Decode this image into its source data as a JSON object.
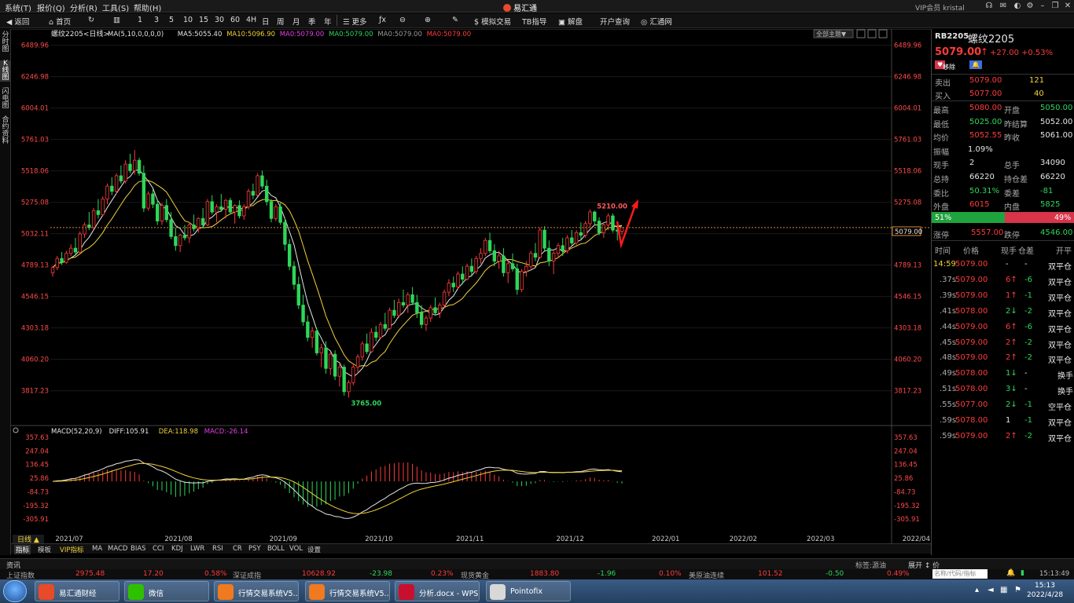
{
  "menu": {
    "items": [
      "系统(T)",
      "报价(Q)",
      "分析(R)",
      "工具(S)",
      "帮助(H)"
    ],
    "app_title": "易汇通",
    "user": "VIP会员 kristal"
  },
  "toolbar": {
    "back": "返回",
    "home": "首页",
    "periods": [
      "1",
      "3",
      "5",
      "10",
      "15",
      "30",
      "60",
      "4H",
      "日",
      "周",
      "月",
      "季",
      "年"
    ],
    "more": "更多",
    "sim_trade": "模拟交易",
    "tb_index": "TB指导",
    "jiepan": "解盘",
    "kaihu": "开户查询",
    "huitong": "汇通网"
  },
  "left_tabs": [
    "分时图",
    "K线图",
    "闪电图",
    "合约资料"
  ],
  "chart": {
    "symbol_label": "螺纹2205<日线>",
    "ma_legend": [
      {
        "text": "MA(5,10,0,0,0,0)",
        "color": "#e6e6e6"
      },
      {
        "text": "MA5:5055.40",
        "color": "#e6e6e6"
      },
      {
        "text": "MA10:5096.90",
        "color": "#f1d23a"
      },
      {
        "text": "MA0:5079.00",
        "color": "#e040e0"
      },
      {
        "text": "MA0:5079.00",
        "color": "#2fd65b"
      },
      {
        "text": "MA0:5079.00",
        "color": "#9a9a9a"
      },
      {
        "text": "MA0:5079.00",
        "color": "#ff3b3b"
      }
    ],
    "theme_button": "全部主题▼",
    "price_axis": [
      "6489.96",
      "6246.98",
      "6004.01",
      "5761.03",
      "5518.06",
      "5275.08",
      "5032.11",
      "4789.13",
      "4546.15",
      "4303.18",
      "4060.20",
      "3817.23"
    ],
    "current_price": "5079.00",
    "high_label": "5210.00",
    "low_label": "3765.00",
    "macd_legend": [
      {
        "text": "MACD(52,20,9)",
        "color": "#e6e6e6"
      },
      {
        "text": "DIFF:105.91",
        "color": "#e6e6e6"
      },
      {
        "text": "DEA:118.98",
        "color": "#f1d23a"
      },
      {
        "text": "MACD:-26.14",
        "color": "#e040e0"
      }
    ],
    "macd_axis": [
      "357.63",
      "247.04",
      "136.45",
      "25.86",
      "-84.73",
      "-195.32",
      "-305.91"
    ],
    "date_axis": [
      "2021/07",
      "2021/08",
      "2021/09",
      "2021/10",
      "2021/11",
      "2021/12",
      "2022/01",
      "2022/02",
      "2022/03",
      "2022/04"
    ],
    "period_label": "日线 ▲"
  },
  "bottom_tabs": [
    "指标",
    "模板",
    "VIP指标",
    "MA",
    "MACD",
    "BIAS",
    "CCI",
    "KDJ",
    "LWR",
    "RSI",
    "CR",
    "PSY",
    "BOLL",
    "VOL",
    "设置"
  ],
  "quote": {
    "code": "RB2205",
    "name": "螺纹2205",
    "price": "5079.00",
    "change": "+27.00",
    "pct": "+0.53%",
    "remove_btn": "移除",
    "sell": {
      "label": "卖出",
      "price": "5079.00",
      "vol": "121"
    },
    "buy": {
      "label": "买入",
      "price": "5077.00",
      "vol": "40"
    },
    "rows": [
      [
        "最高",
        "5080.00",
        "开盘",
        "5050.00"
      ],
      [
        "最低",
        "5025.00",
        "昨结算",
        "5052.00"
      ],
      [
        "均价",
        "5052.55",
        "昨收",
        "5061.00"
      ],
      [
        "振幅",
        "1.09%",
        "",
        ""
      ],
      [
        "现手",
        "2",
        "总手",
        "34090"
      ],
      [
        "总持",
        "66220",
        "持仓差",
        "66220"
      ],
      [
        "委比",
        "50.31%",
        "委差",
        "-81"
      ],
      [
        "外盘",
        "6015",
        "内盘",
        "5825"
      ]
    ],
    "bar_left": "51%",
    "bar_right": "49%",
    "limit": [
      "涨停",
      "5557.00",
      "跌停",
      "4546.00"
    ],
    "trade_headers": [
      "时间",
      "价格",
      "现手",
      "仓差",
      "开平"
    ],
    "trades": [
      [
        "14:59",
        "5079.00",
        "-",
        "-",
        "双平仓"
      ],
      [
        ".37s",
        "5079.00",
        "6↑",
        "-6",
        "双平仓"
      ],
      [
        ".39s",
        "5079.00",
        "1↑",
        "-1",
        "双平仓"
      ],
      [
        ".41s",
        "5078.00",
        "2↓",
        "-2",
        "双平仓"
      ],
      [
        ".44s",
        "5079.00",
        "6↑",
        "-6",
        "双平仓"
      ],
      [
        ".45s",
        "5079.00",
        "2↑",
        "-2",
        "双平仓"
      ],
      [
        ".48s",
        "5079.00",
        "2↑",
        "-2",
        "双平仓"
      ],
      [
        ".49s",
        "5078.00",
        "1↓",
        "-",
        "换手"
      ],
      [
        ".51s",
        "5078.00",
        "3↓",
        "-",
        "换手"
      ],
      [
        ".55s",
        "5077.00",
        "2↓",
        "-1",
        "空平仓"
      ],
      [
        ".59s",
        "5078.00",
        "1",
        "-1",
        "双平仓"
      ],
      [
        ".59s",
        "5079.00",
        "2↑",
        "-2",
        "双平仓"
      ]
    ]
  },
  "newsbar": {
    "left": "资讯",
    "tag": "标签:源油",
    "expand": "展开",
    "hint": "名称/代码/指标",
    "time": "15:13:49"
  },
  "ticker": [
    {
      "name": "上证指数",
      "val": "2975.48",
      "chg": "17.20",
      "pct": "0.58%"
    },
    {
      "name": "深证成指",
      "val": "10628.92",
      "chg": "-23.98",
      "pct": "0.23%"
    },
    {
      "name": "现货黄金",
      "val": "1883.80",
      "chg": "-1.96",
      "pct": "0.10%"
    },
    {
      "name": "美原油连续",
      "val": "101.52",
      "chg": "-0.50",
      "pct": "0.49%"
    }
  ],
  "taskbar": {
    "items": [
      {
        "label": "易汇通财经",
        "color": "#e84a2a"
      },
      {
        "label": "微信",
        "color": "#2dc100"
      },
      {
        "label": "行情交易系统V5....",
        "color": "#f07a1f"
      },
      {
        "label": "行情交易系统V5....",
        "color": "#f07a1f"
      },
      {
        "label": "分析.docx - WPS...",
        "color": "#c8102e"
      },
      {
        "label": "Pointofix",
        "color": "#d8d8d8"
      }
    ],
    "time": "15:13",
    "date": "2022/4/28"
  },
  "chart_data": {
    "type": "candlestick",
    "title": "螺纹2205<日线>",
    "x_range": [
      "2021/06/24",
      "2022/04/28"
    ],
    "y_range": [
      3700,
      6500
    ],
    "ohlc": [
      [
        4730,
        4780,
        4700,
        4770
      ],
      [
        4770,
        4860,
        4750,
        4840
      ],
      [
        4840,
        4890,
        4790,
        4810
      ],
      [
        4810,
        4900,
        4800,
        4880
      ],
      [
        4880,
        4950,
        4860,
        4920
      ],
      [
        4920,
        5000,
        4870,
        4890
      ],
      [
        4890,
        5050,
        4880,
        5030
      ],
      [
        5030,
        5120,
        5000,
        5100
      ],
      [
        5100,
        5200,
        5060,
        5080
      ],
      [
        5080,
        5230,
        5070,
        5210
      ],
      [
        5210,
        5300,
        5150,
        5180
      ],
      [
        5180,
        5320,
        5170,
        5300
      ],
      [
        5300,
        5420,
        5260,
        5400
      ],
      [
        5400,
        5470,
        5330,
        5360
      ],
      [
        5360,
        5500,
        5340,
        5480
      ],
      [
        5480,
        5560,
        5420,
        5440
      ],
      [
        5440,
        5600,
        5420,
        5570
      ],
      [
        5570,
        5650,
        5500,
        5520
      ],
      [
        5520,
        5680,
        5490,
        5600
      ],
      [
        5600,
        5620,
        5480,
        5500
      ],
      [
        5500,
        5560,
        5200,
        5230
      ],
      [
        5230,
        5360,
        5210,
        5340
      ],
      [
        5340,
        5380,
        5230,
        5260
      ],
      [
        5260,
        5300,
        5100,
        5130
      ],
      [
        5130,
        5270,
        5100,
        5250
      ],
      [
        5250,
        5300,
        5120,
        5140
      ],
      [
        5140,
        5200,
        4990,
        5010
      ],
      [
        5010,
        5080,
        4900,
        4940
      ],
      [
        4940,
        5030,
        4890,
        5020
      ],
      [
        5020,
        5100,
        4980,
        5000
      ],
      [
        5000,
        5120,
        4960,
        5100
      ],
      [
        5100,
        5180,
        5050,
        5070
      ],
      [
        5070,
        5160,
        5040,
        5150
      ],
      [
        5150,
        5230,
        5080,
        5100
      ],
      [
        5100,
        5300,
        5090,
        5280
      ],
      [
        5280,
        5330,
        5180,
        5200
      ],
      [
        5200,
        5260,
        5120,
        5240
      ],
      [
        5240,
        5340,
        5200,
        5220
      ],
      [
        5220,
        5300,
        5150,
        5290
      ],
      [
        5290,
        5310,
        5180,
        5200
      ],
      [
        5200,
        5260,
        5110,
        5250
      ],
      [
        5250,
        5290,
        5150,
        5170
      ],
      [
        5170,
        5260,
        5140,
        5240
      ],
      [
        5240,
        5380,
        5220,
        5360
      ],
      [
        5360,
        5420,
        5300,
        5330
      ],
      [
        5330,
        5500,
        5320,
        5480
      ],
      [
        5480,
        5520,
        5380,
        5400
      ],
      [
        5400,
        5450,
        5250,
        5280
      ],
      [
        5280,
        5300,
        5120,
        5150
      ],
      [
        5150,
        5260,
        5130,
        5240
      ],
      [
        5240,
        5270,
        5100,
        5120
      ],
      [
        5120,
        5150,
        4900,
        4950
      ],
      [
        4950,
        4990,
        4750,
        4780
      ],
      [
        4780,
        4820,
        4600,
        4640
      ],
      [
        4640,
        4700,
        4450,
        4480
      ],
      [
        4480,
        4560,
        4320,
        4350
      ],
      [
        4350,
        4400,
        4200,
        4230
      ],
      [
        4230,
        4310,
        4150,
        4280
      ],
      [
        4280,
        4300,
        4090,
        4110
      ],
      [
        4110,
        4180,
        4000,
        4150
      ],
      [
        4150,
        4200,
        3950,
        3990
      ],
      [
        3990,
        4120,
        3940,
        4100
      ],
      [
        4100,
        4130,
        3900,
        3930
      ],
      [
        3930,
        4030,
        3850,
        4000
      ],
      [
        4000,
        4020,
        3780,
        3810
      ],
      [
        3810,
        3900,
        3765,
        3880
      ],
      [
        3880,
        4020,
        3860,
        4000
      ],
      [
        4000,
        4100,
        3950,
        4080
      ],
      [
        4080,
        4200,
        4050,
        4180
      ],
      [
        4180,
        4260,
        4100,
        4120
      ],
      [
        4120,
        4300,
        4110,
        4270
      ],
      [
        4270,
        4320,
        4200,
        4230
      ],
      [
        4230,
        4350,
        4220,
        4330
      ],
      [
        4330,
        4420,
        4280,
        4300
      ],
      [
        4300,
        4460,
        4290,
        4440
      ],
      [
        4440,
        4520,
        4380,
        4400
      ],
      [
        4400,
        4530,
        4380,
        4500
      ],
      [
        4500,
        4600,
        4460,
        4480
      ],
      [
        4480,
        4580,
        4420,
        4560
      ],
      [
        4560,
        4620,
        4480,
        4500
      ],
      [
        4500,
        4560,
        4380,
        4420
      ],
      [
        4420,
        4480,
        4300,
        4330
      ],
      [
        4330,
        4400,
        4280,
        4380
      ],
      [
        4380,
        4480,
        4350,
        4460
      ],
      [
        4460,
        4540,
        4400,
        4420
      ],
      [
        4420,
        4500,
        4380,
        4480
      ],
      [
        4480,
        4600,
        4460,
        4580
      ],
      [
        4580,
        4680,
        4550,
        4650
      ],
      [
        4650,
        4700,
        4580,
        4620
      ],
      [
        4620,
        4740,
        4600,
        4720
      ],
      [
        4720,
        4780,
        4640,
        4680
      ],
      [
        4680,
        4800,
        4670,
        4780
      ],
      [
        4780,
        4840,
        4700,
        4740
      ],
      [
        4740,
        4860,
        4720,
        4840
      ],
      [
        4840,
        4920,
        4800,
        4880
      ],
      [
        4880,
        5000,
        4860,
        4980
      ],
      [
        4980,
        5040,
        4880,
        4900
      ],
      [
        4900,
        4950,
        4780,
        4820
      ],
      [
        4820,
        4900,
        4760,
        4860
      ],
      [
        4860,
        4920,
        4700,
        4730
      ],
      [
        4730,
        4820,
        4650,
        4800
      ],
      [
        4800,
        4880,
        4740,
        4760
      ],
      [
        4760,
        4800,
        4560,
        4600
      ],
      [
        4600,
        4760,
        4580,
        4740
      ],
      [
        4740,
        4820,
        4700,
        4780
      ],
      [
        4780,
        4900,
        4760,
        4880
      ],
      [
        4880,
        4960,
        4820,
        4850
      ],
      [
        4850,
        5080,
        4840,
        5060
      ],
      [
        5060,
        5090,
        4900,
        4920
      ],
      [
        4920,
        4980,
        4780,
        4820
      ],
      [
        4820,
        4900,
        4720,
        4880
      ],
      [
        4880,
        4960,
        4840,
        4940
      ],
      [
        4940,
        5000,
        4860,
        4900
      ],
      [
        4900,
        5020,
        4880,
        5000
      ],
      [
        5000,
        5060,
        4940,
        4960
      ],
      [
        4960,
        5060,
        4940,
        5040
      ],
      [
        5040,
        5120,
        4990,
        5020
      ],
      [
        5020,
        5130,
        5000,
        5110
      ],
      [
        5110,
        5220,
        5080,
        5200
      ],
      [
        5200,
        5210,
        5100,
        5130
      ],
      [
        5130,
        5160,
        5020,
        5040
      ],
      [
        5040,
        5120,
        5000,
        5100
      ],
      [
        5100,
        5190,
        5060,
        5170
      ],
      [
        5170,
        5190,
        5040,
        5060
      ],
      [
        5060,
        5080,
        4980,
        5052
      ],
      [
        5050,
        5080,
        5025,
        5079
      ]
    ]
  }
}
